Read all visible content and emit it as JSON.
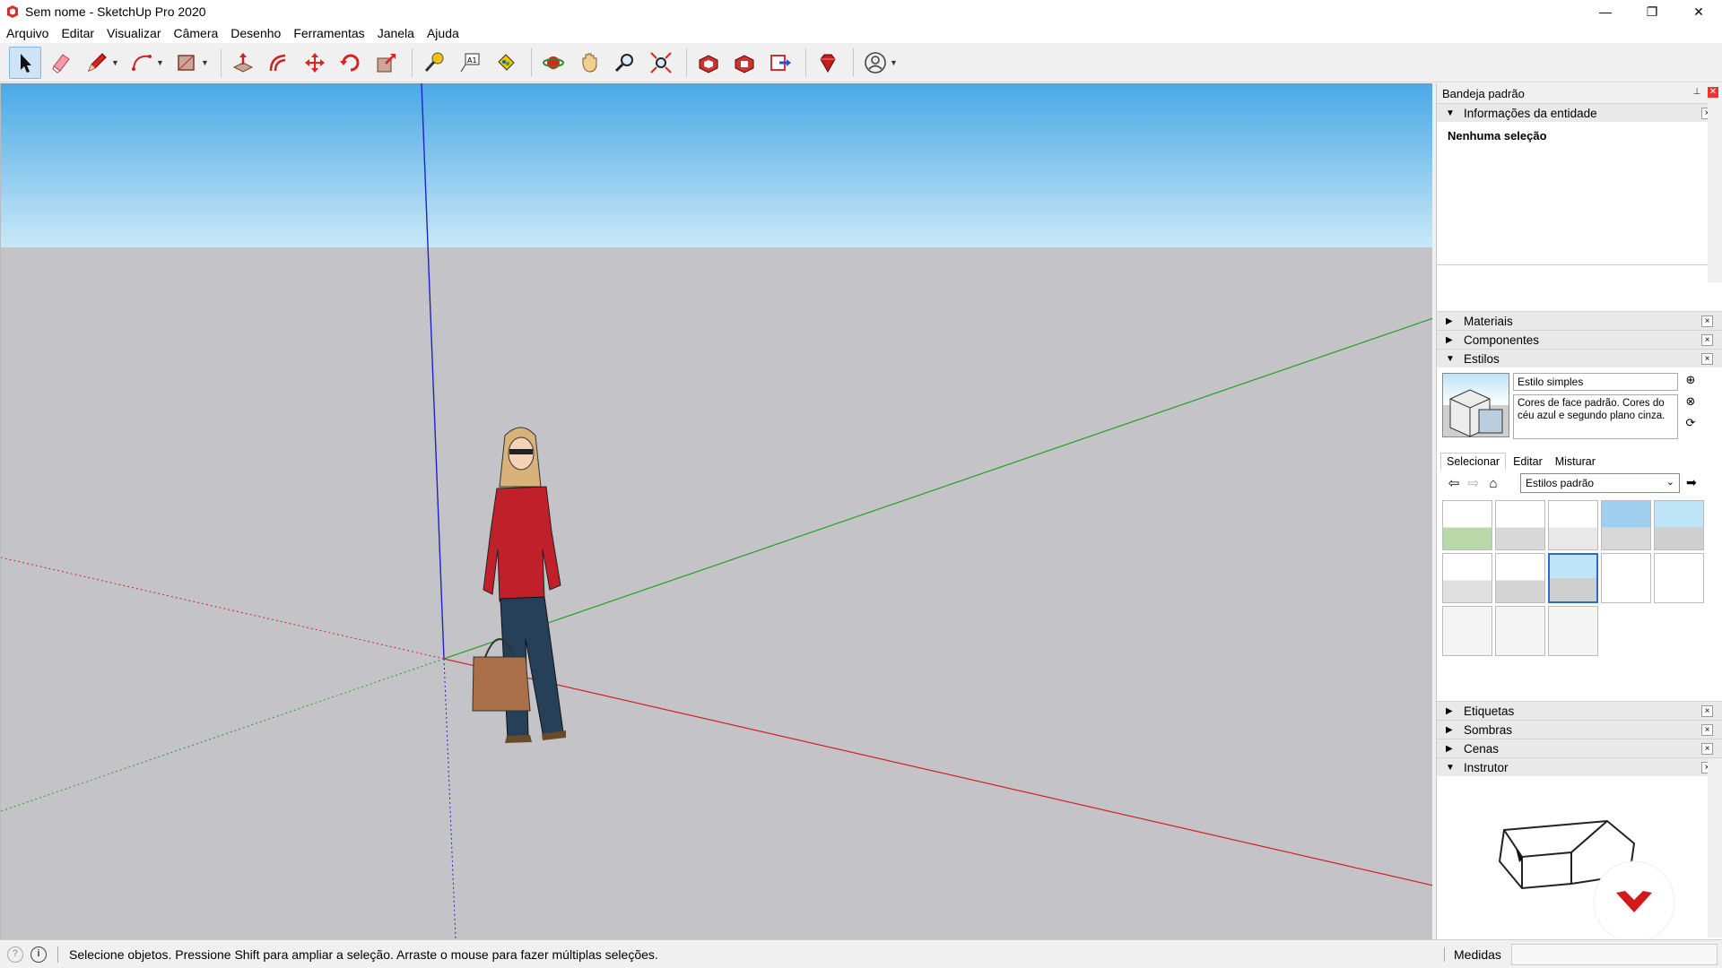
{
  "window": {
    "title": "Sem nome - SketchUp Pro 2020",
    "minimize": "—",
    "restore": "❐",
    "close": "✕"
  },
  "menu": [
    "Arquivo",
    "Editar",
    "Visualizar",
    "Câmera",
    "Desenho",
    "Ferramentas",
    "Janela",
    "Ajuda"
  ],
  "tray": {
    "title": "Bandeja padrão",
    "entity_info": {
      "title": "Informações da entidade",
      "selection": "Nenhuma seleção"
    },
    "materials": "Materiais",
    "components": "Componentes",
    "styles": {
      "title": "Estilos",
      "name": "Estilo simples",
      "description": "Cores de face padrão. Cores do céu azul e segundo plano cinza.",
      "tabs": [
        "Selecionar",
        "Editar",
        "Misturar"
      ],
      "library": "Estilos padrão"
    },
    "tags": "Etiquetas",
    "shadows": "Sombras",
    "scenes": "Cenas",
    "instructor": "Instrutor"
  },
  "status": {
    "text": "Selecione objetos. Pressione Shift para ampliar a seleção. Arraste o mouse para fazer múltiplas seleções.",
    "measures_label": "Medidas"
  },
  "colors": {
    "sky_top": "#4aa8e6",
    "ground": "#c4c4c8",
    "red_axis": "#d22222",
    "green_axis": "#22a022",
    "blue_axis": "#2222cc"
  }
}
